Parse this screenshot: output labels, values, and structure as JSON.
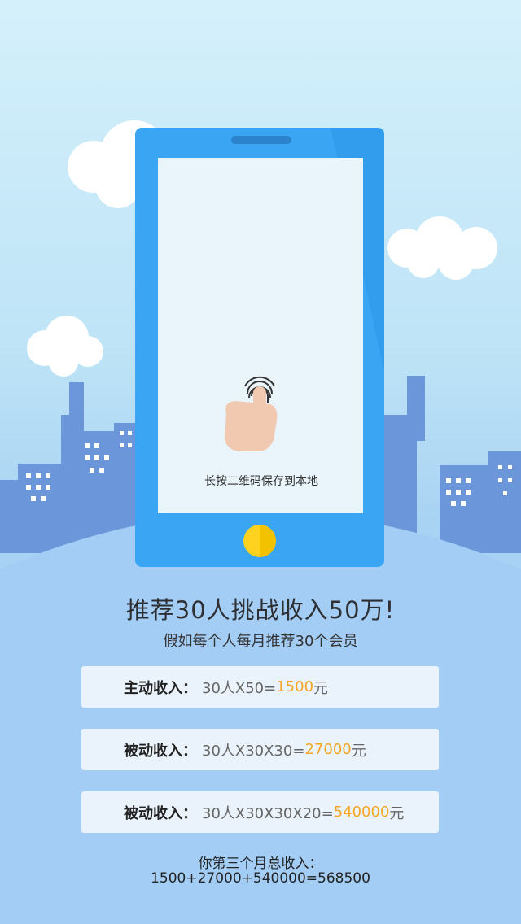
{
  "screen": {
    "hint": "长按二维码保存到本地"
  },
  "headline": "推荐30人挑战收入50万!",
  "subline": "假如每个人每月推荐30个会员",
  "income_cards": [
    {
      "label": "主动收入：",
      "formula": "30人X50=",
      "amount": "1500",
      "unit": "元"
    },
    {
      "label": "被动收入：",
      "formula": "30人X30X30=",
      "amount": "27000",
      "unit": "元"
    },
    {
      "label": "被动收入：",
      "formula": "30人X30X30X20=",
      "amount": "540000",
      "unit": "元"
    }
  ],
  "total": {
    "label": "你第三个月总收入：",
    "equation": "1500+27000+540000=568500"
  },
  "colors": {
    "highlight": "#f6a623",
    "phone_body": "#3aa6f3",
    "city": "#6b97da",
    "home_button": "#ffd21f"
  }
}
